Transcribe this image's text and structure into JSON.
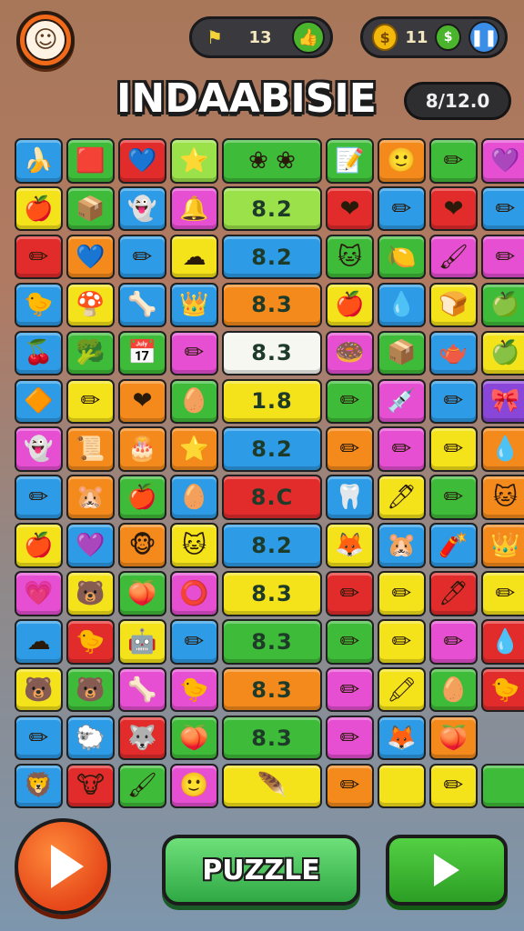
{
  "header": {
    "avatar_icon": "player-face-icon",
    "level_pill": {
      "icon": "flag-icon",
      "value": "13",
      "button_icon": "thumbs-up-icon"
    },
    "coin_pill": {
      "icon": "coin-icon",
      "value": "11",
      "button_icon": "pause-icon"
    },
    "title": "INDAABISIE",
    "score": "8/12.0"
  },
  "palette": {
    "blue": "#2d9be6",
    "green": "#3fbb3a",
    "red": "#e22b2b",
    "yellow": "#f4e21a",
    "orange": "#f48a1c",
    "pink": "#e64fd2",
    "purple": "#8a46d9",
    "lime": "#9be24a",
    "white": "#f7f7f2",
    "teal": "#34c0c8"
  },
  "grid": {
    "rows": [
      [
        {
          "c": "blue",
          "g": "🍌",
          "n": "banana-icon"
        },
        {
          "c": "green",
          "g": "🟥",
          "n": "flag-icon"
        },
        {
          "c": "red",
          "g": "💙",
          "n": "heart-icon"
        },
        {
          "c": "lime",
          "g": "⭐",
          "n": "star-icon"
        },
        {
          "c": "green",
          "g": "❀ ❀",
          "n": "flowers-icon",
          "w": 2
        },
        {
          "c": "green",
          "g": "📝",
          "n": "note-icon"
        },
        {
          "c": "orange",
          "g": "🙂",
          "n": "face-icon"
        },
        {
          "c": "green",
          "g": "✏",
          "n": "pencil-icon"
        },
        {
          "c": "pink",
          "g": "💜",
          "n": "heart-icon"
        }
      ],
      [
        {
          "c": "yellow",
          "g": "🍎",
          "n": "apple-icon"
        },
        {
          "c": "green",
          "g": "📦",
          "n": "box-icon"
        },
        {
          "c": "blue",
          "g": "👻",
          "n": "ghost-icon"
        },
        {
          "c": "pink",
          "g": "🔔",
          "n": "bell-icon"
        },
        {
          "c": "lime",
          "g": "",
          "n": "number-tile",
          "t": "8.2",
          "w": 2
        },
        {
          "c": "red",
          "g": "❤",
          "n": "heart-icon"
        },
        {
          "c": "blue",
          "g": "✏",
          "n": "pencil-icon"
        },
        {
          "c": "red",
          "g": "❤",
          "n": "heart-icon"
        },
        {
          "c": "blue",
          "g": "✏",
          "n": "pencil-icon"
        }
      ],
      [
        {
          "c": "red",
          "g": "✏",
          "n": "pencil-icon"
        },
        {
          "c": "orange",
          "g": "💙",
          "n": "heart-icon"
        },
        {
          "c": "blue",
          "g": "✏",
          "n": "pencil-icon"
        },
        {
          "c": "yellow",
          "g": "☁",
          "n": "cloud-icon"
        },
        {
          "c": "blue",
          "g": "",
          "n": "number-tile",
          "t": "8.2",
          "w": 2
        },
        {
          "c": "green",
          "g": "🐱",
          "n": "cat-icon"
        },
        {
          "c": "green",
          "g": "🍋",
          "n": "lemon-icon"
        },
        {
          "c": "pink",
          "g": "🖌",
          "n": "brush-icon"
        },
        {
          "c": "pink",
          "g": "✏",
          "n": "pencil-icon"
        }
      ],
      [
        {
          "c": "blue",
          "g": "🐤",
          "n": "chick-icon"
        },
        {
          "c": "yellow",
          "g": "🍄",
          "n": "mushroom-icon"
        },
        {
          "c": "blue",
          "g": "🦴",
          "n": "bone-icon"
        },
        {
          "c": "blue",
          "g": "👑",
          "n": "king-icon"
        },
        {
          "c": "orange",
          "g": "",
          "n": "number-tile",
          "t": "8.3",
          "w": 2
        },
        {
          "c": "yellow",
          "g": "🍎",
          "n": "apple-icon"
        },
        {
          "c": "blue",
          "g": "💧",
          "n": "drop-icon"
        },
        {
          "c": "yellow",
          "g": "🍞",
          "n": "bread-icon"
        },
        {
          "c": "green",
          "g": "🍏",
          "n": "apple-icon"
        }
      ],
      [
        {
          "c": "blue",
          "g": "🍒",
          "n": "cherry-icon"
        },
        {
          "c": "green",
          "g": "🥦",
          "n": "broccoli-icon"
        },
        {
          "c": "green",
          "g": "📅",
          "n": "calendar-icon"
        },
        {
          "c": "pink",
          "g": "✏",
          "n": "pencil-icon"
        },
        {
          "c": "white",
          "g": "",
          "n": "number-tile",
          "t": "8.3",
          "w": 2
        },
        {
          "c": "pink",
          "g": "🍩",
          "n": "donut-icon"
        },
        {
          "c": "green",
          "g": "📦",
          "n": "box-icon"
        },
        {
          "c": "blue",
          "g": "🫖",
          "n": "teapot-icon"
        },
        {
          "c": "yellow",
          "g": "🍏",
          "n": "apple-icon"
        }
      ],
      [
        {
          "c": "blue",
          "g": "🔶",
          "n": "diamond-icon"
        },
        {
          "c": "yellow",
          "g": "✏",
          "n": "pencil-icon"
        },
        {
          "c": "orange",
          "g": "❤",
          "n": "heart-icon"
        },
        {
          "c": "green",
          "g": "🥚",
          "n": "egg-icon"
        },
        {
          "c": "yellow",
          "g": "",
          "n": "number-tile",
          "t": "1.8",
          "w": 2
        },
        {
          "c": "green",
          "g": "✏",
          "n": "pencil-icon"
        },
        {
          "c": "pink",
          "g": "💉",
          "n": "syringe-icon"
        },
        {
          "c": "blue",
          "g": "✏",
          "n": "pencil-icon"
        },
        {
          "c": "purple",
          "g": "🎀",
          "n": "bow-icon"
        }
      ],
      [
        {
          "c": "pink",
          "g": "👻",
          "n": "ghost-icon"
        },
        {
          "c": "orange",
          "g": "📜",
          "n": "scroll-icon"
        },
        {
          "c": "orange",
          "g": "🎂",
          "n": "cake-icon"
        },
        {
          "c": "orange",
          "g": "⭐",
          "n": "star-icon"
        },
        {
          "c": "blue",
          "g": "",
          "n": "number-tile",
          "t": "8.2",
          "w": 2
        },
        {
          "c": "orange",
          "g": "✏",
          "n": "pencil-icon"
        },
        {
          "c": "pink",
          "g": "✏",
          "n": "pencil-icon"
        },
        {
          "c": "yellow",
          "g": "✏",
          "n": "pencil-icon"
        },
        {
          "c": "orange",
          "g": "💧",
          "n": "drop-icon"
        }
      ],
      [
        {
          "c": "blue",
          "g": "✏",
          "n": "pencil-icon"
        },
        {
          "c": "orange",
          "g": "🐹",
          "n": "hamster-icon"
        },
        {
          "c": "green",
          "g": "🍎",
          "n": "apple-icon"
        },
        {
          "c": "blue",
          "g": "🥚",
          "n": "egg-icon"
        },
        {
          "c": "red",
          "g": "",
          "n": "number-tile",
          "t": "8.C",
          "w": 2
        },
        {
          "c": "blue",
          "g": "🦷",
          "n": "tooth-icon"
        },
        {
          "c": "yellow",
          "g": "🖊",
          "n": "pen-icon"
        },
        {
          "c": "green",
          "g": "✏",
          "n": "pencil-icon"
        },
        {
          "c": "orange",
          "g": "🐱",
          "n": "cat-icon"
        }
      ],
      [
        {
          "c": "yellow",
          "g": "🍎",
          "n": "apple-icon"
        },
        {
          "c": "blue",
          "g": "💜",
          "n": "heart-icon"
        },
        {
          "c": "orange",
          "g": "🐵",
          "n": "monkey-icon"
        },
        {
          "c": "yellow",
          "g": "🐱",
          "n": "cat-icon"
        },
        {
          "c": "blue",
          "g": "",
          "n": "number-tile",
          "t": "8.2",
          "w": 2
        },
        {
          "c": "yellow",
          "g": "🦊",
          "n": "fox-icon"
        },
        {
          "c": "blue",
          "g": "🐹",
          "n": "hamster-icon"
        },
        {
          "c": "blue",
          "g": "🧨",
          "n": "firecracker-icon"
        },
        {
          "c": "orange",
          "g": "👑",
          "n": "king-icon"
        }
      ],
      [
        {
          "c": "pink",
          "g": "💗",
          "n": "heart-icon"
        },
        {
          "c": "yellow",
          "g": "🐻",
          "n": "bear-icon"
        },
        {
          "c": "green",
          "g": "🍑",
          "n": "peach-icon"
        },
        {
          "c": "pink",
          "g": "⭕",
          "n": "ring-icon"
        },
        {
          "c": "yellow",
          "g": "",
          "n": "number-tile",
          "t": "8.3",
          "w": 2
        },
        {
          "c": "red",
          "g": "✏",
          "n": "pencil-icon"
        },
        {
          "c": "yellow",
          "g": "✏",
          "n": "pencil-icon"
        },
        {
          "c": "red",
          "g": "🖊",
          "n": "pen-icon"
        },
        {
          "c": "yellow",
          "g": "✏",
          "n": "pencil-icon"
        }
      ],
      [
        {
          "c": "blue",
          "g": "☁",
          "n": "cloud-icon"
        },
        {
          "c": "red",
          "g": "🐤",
          "n": "chick-icon"
        },
        {
          "c": "yellow",
          "g": "🤖",
          "n": "robot-icon"
        },
        {
          "c": "blue",
          "g": "✏",
          "n": "pencil-icon"
        },
        {
          "c": "green",
          "g": "",
          "n": "number-tile",
          "t": "8.3",
          "w": 2
        },
        {
          "c": "green",
          "g": "✏",
          "n": "pencil-icon"
        },
        {
          "c": "yellow",
          "g": "✏",
          "n": "pencil-icon"
        },
        {
          "c": "pink",
          "g": "✏",
          "n": "pencil-icon"
        },
        {
          "c": "red",
          "g": "💧",
          "n": "drop-icon"
        }
      ],
      [
        {
          "c": "yellow",
          "g": "🐻",
          "n": "bear-icon"
        },
        {
          "c": "green",
          "g": "🐻",
          "n": "bear-icon"
        },
        {
          "c": "pink",
          "g": "🦴",
          "n": "bone-icon"
        },
        {
          "c": "pink",
          "g": "🐤",
          "n": "chick-icon"
        },
        {
          "c": "orange",
          "g": "",
          "n": "number-tile",
          "t": "8.3",
          "w": 2
        },
        {
          "c": "pink",
          "g": "✏",
          "n": "pencil-icon"
        },
        {
          "c": "yellow",
          "g": "🖍",
          "n": "crayon-icon"
        },
        {
          "c": "green",
          "g": "🥚",
          "n": "egg-icon"
        },
        {
          "c": "red",
          "g": "🐤",
          "n": "chick-icon"
        }
      ],
      [
        {
          "c": "blue",
          "g": "✏",
          "n": "pencil-icon"
        },
        {
          "c": "blue",
          "g": "🐑",
          "n": "sheep-icon"
        },
        {
          "c": "red",
          "g": "🐺",
          "n": "wolf-icon"
        },
        {
          "c": "green",
          "g": "🍑",
          "n": "peach-icon"
        },
        {
          "c": "green",
          "g": "",
          "n": "number-tile",
          "t": "8.3",
          "w": 2
        },
        {
          "c": "pink",
          "g": "✏",
          "n": "pencil-icon"
        },
        {
          "c": "blue",
          "g": "🦊",
          "n": "fox-icon"
        },
        {
          "c": "orange",
          "g": "🍑",
          "n": "peach-icon"
        },
        null
      ],
      [
        {
          "c": "blue",
          "g": "🦁",
          "n": "lion-icon"
        },
        {
          "c": "red",
          "g": "🐮",
          "n": "cow-icon"
        },
        {
          "c": "green",
          "g": "🖌",
          "n": "brush-icon"
        },
        {
          "c": "pink",
          "g": "🙂",
          "n": "face-icon"
        },
        {
          "c": "yellow",
          "g": "🪶",
          "n": "feather-icon",
          "w": 2
        },
        {
          "c": "orange",
          "g": "✏",
          "n": "pencil-icon"
        },
        {
          "c": "yellow",
          "g": "",
          "n": "empty-tile"
        },
        {
          "c": "yellow",
          "g": "✏",
          "n": "pencil-icon"
        },
        {
          "c": "green",
          "g": "",
          "n": "empty-tile"
        }
      ]
    ]
  },
  "bottom": {
    "play_icon": "play-icon",
    "puzzle_label": "PUZZLE",
    "next_icon": "next-arrow-icon"
  }
}
